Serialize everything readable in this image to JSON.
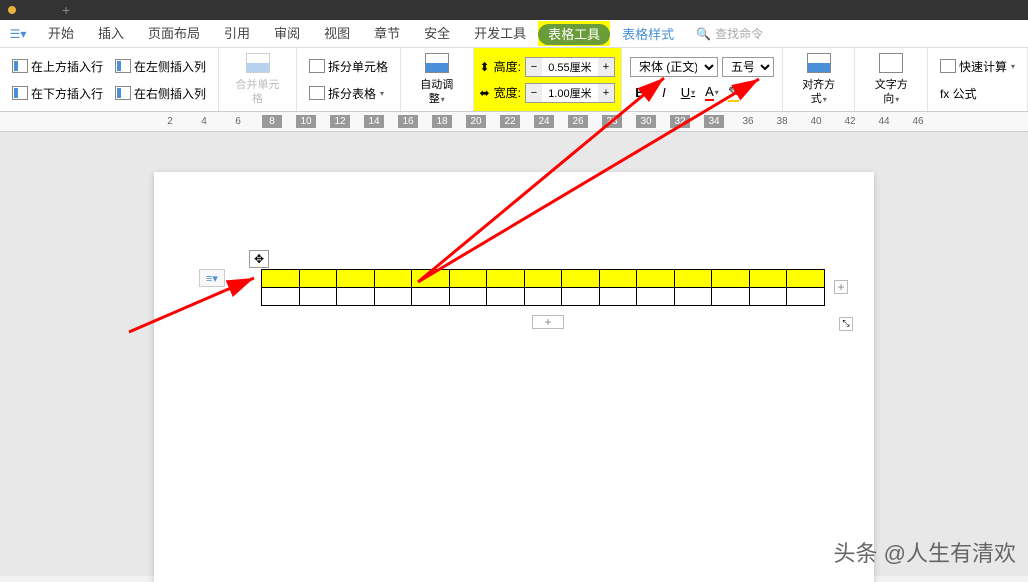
{
  "titlebar": {
    "add_tab": "+"
  },
  "menu": {
    "items": [
      "开始",
      "插入",
      "页面布局",
      "引用",
      "审阅",
      "视图",
      "章节",
      "安全",
      "开发工具"
    ],
    "active_tab": "表格工具",
    "style_tab": "表格样式",
    "search_placeholder": "查找命令"
  },
  "ribbon": {
    "insert_above": "在上方插入行",
    "insert_below": "在下方插入行",
    "insert_left": "在左侧插入列",
    "insert_right": "在右侧插入列",
    "merge_cells": "合并单元格",
    "split_cells": "拆分单元格",
    "split_table": "拆分表格",
    "autofit": "自动调整",
    "height_label": "高度:",
    "height_value": "0.55厘米",
    "width_label": "宽度:",
    "width_value": "1.00厘米",
    "font_name": "宋体 (正文)",
    "font_size": "五号",
    "align": "对齐方式",
    "text_dir": "文字方向",
    "quick_calc": "快速计算",
    "formula": "fx 公式",
    "minus": "−",
    "plus": "+",
    "bold": "B",
    "italic": "I",
    "underline": "U",
    "font_color": "A",
    "highlight": "✎"
  },
  "ruler": {
    "marks": [
      "2",
      "4",
      "6",
      "8",
      "10",
      "12",
      "14",
      "16",
      "18",
      "20",
      "22",
      "24",
      "26",
      "28",
      "30",
      "32",
      "34",
      "36",
      "38",
      "40",
      "42",
      "44",
      "46"
    ]
  },
  "page": {
    "move_handle": "✥",
    "add": "+",
    "resize": "⤡",
    "para": "≡▾"
  },
  "watermark": "头条 @人生有清欢"
}
